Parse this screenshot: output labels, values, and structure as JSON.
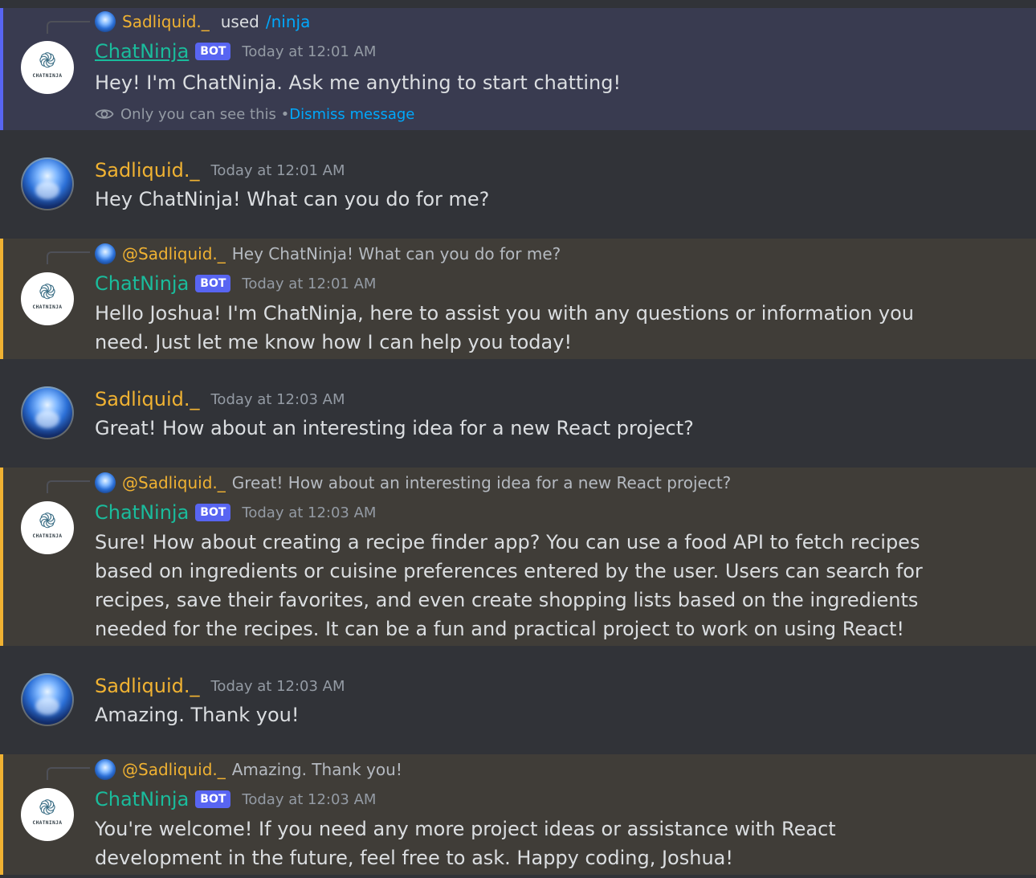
{
  "messages": [
    {
      "type": "bot-ephemeral",
      "command_user": "Sadliquid._",
      "used_text": "used",
      "command": "/ninja",
      "author": "ChatNinja",
      "badge": "BOT",
      "timestamp": "Today at 12:01 AM",
      "text": "Hey! I'm ChatNinja. Ask me anything to start chatting!",
      "note": "Only you can see this • ",
      "dismiss": "Dismiss message"
    },
    {
      "type": "user",
      "author": "Sadliquid._",
      "timestamp": "Today at 12:01 AM",
      "text": "Hey ChatNinja! What can you do for me?"
    },
    {
      "type": "bot-reply",
      "reply_to": "@Sadliquid._",
      "reply_preview": "Hey ChatNinja! What can you do for me?",
      "author": "ChatNinja",
      "badge": "BOT",
      "timestamp": "Today at 12:01 AM",
      "text": "Hello Joshua! I'm ChatNinja, here to assist you with any questions or information you need. Just let me know how I can help you today!"
    },
    {
      "type": "user",
      "author": "Sadliquid._",
      "timestamp": "Today at 12:03 AM",
      "text": "Great! How about an interesting idea for a new React project?"
    },
    {
      "type": "bot-reply",
      "reply_to": "@Sadliquid._",
      "reply_preview": "Great! How about an interesting idea for a new React project?",
      "author": "ChatNinja",
      "badge": "BOT",
      "timestamp": "Today at 12:03 AM",
      "text": "Sure! How about creating a recipe finder app? You can use a food API to fetch recipes based on ingredients or cuisine preferences entered by the user. Users can search for recipes, save their favorites, and even create shopping lists based on the ingredients needed for the recipes. It can be a fun and practical project to work on using React!"
    },
    {
      "type": "user",
      "author": "Sadliquid._",
      "timestamp": "Today at 12:03 AM",
      "text": "Amazing. Thank you!"
    },
    {
      "type": "bot-reply",
      "reply_to": "@Sadliquid._",
      "reply_preview": "Amazing. Thank you!",
      "author": "ChatNinja",
      "badge": "BOT",
      "timestamp": "Today at 12:03 AM",
      "text": "You're welcome! If you need any more project ideas or assistance with React development in the future, feel free to ask. Happy coding, Joshua!"
    }
  ],
  "bot_avatar_text": "CHATNINJA",
  "colors": {
    "background": "#313338",
    "ephemeral_bg": "#393b50",
    "mention_bg": "#403d38",
    "bot_name": "#1abc9c",
    "user_name": "#f0b232",
    "link": "#00a8fc",
    "badge": "#5865f2"
  }
}
